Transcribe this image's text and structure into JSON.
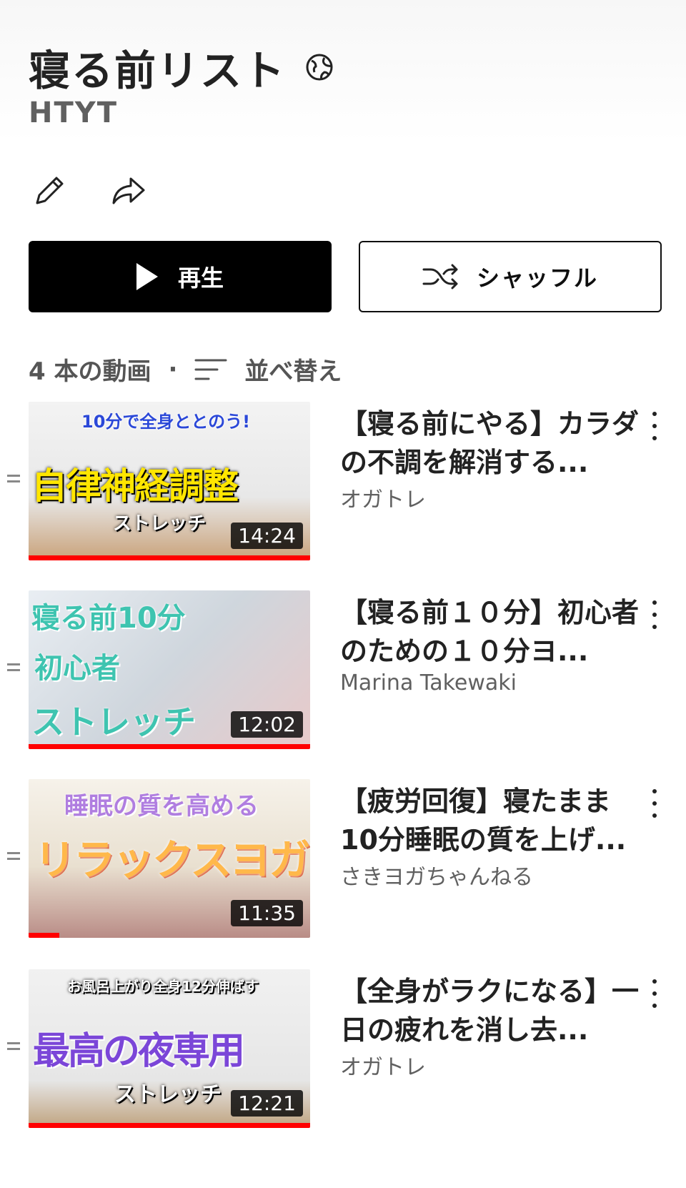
{
  "playlist": {
    "title": "寝る前リスト",
    "privacy_icon": "globe-icon",
    "owner": "HTYT"
  },
  "actions": {
    "edit_icon": "pencil-icon",
    "share_icon": "share-icon",
    "play_label": "再生",
    "shuffle_label": "シャッフル"
  },
  "meta": {
    "video_count": "4 本の動画",
    "separator": "·",
    "sort_label": "並べ替え"
  },
  "videos": [
    {
      "title": "【寝る前にやる】カラダの不調を解消する...",
      "channel": "オガトレ",
      "duration": "14:24",
      "progress_fraction": 1.0,
      "thumb_top": "10分で全身ととのう!",
      "thumb_main": "自律神経調整",
      "thumb_sub": "ストレッチ"
    },
    {
      "title": "【寝る前１０分】初心者のための１０分ヨ...",
      "channel": "Marina Takewaki",
      "duration": "12:02",
      "progress_fraction": 1.0,
      "thumb_top": "寝る前10分",
      "thumb_main": "初心者",
      "thumb_sub": "ストレッチ"
    },
    {
      "title": "【疲労回復】寝たまま10分睡眠の質を上げ...",
      "channel": "さきヨガちゃんねる",
      "duration": "11:35",
      "progress_fraction": 0.11,
      "thumb_top": "睡眠の質を高める",
      "thumb_main": "リラックスヨガ",
      "thumb_sub": ""
    },
    {
      "title": "【全身がラクになる】一日の疲れを消し去...",
      "channel": "オガトレ",
      "duration": "12:21",
      "progress_fraction": 1.0,
      "thumb_top": "お風呂上がり全身12分伸ばす",
      "thumb_main": "最高の夜専用",
      "thumb_sub": "ストレッチ"
    }
  ],
  "colors": {
    "progress": "#ff0000",
    "primary_button": "#000000"
  }
}
